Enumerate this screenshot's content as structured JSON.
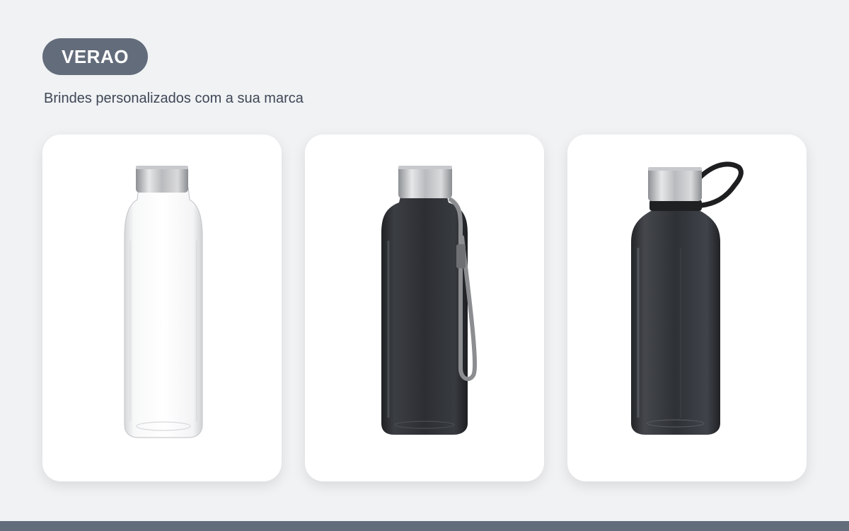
{
  "header": {
    "badge_label": "VERAO",
    "subtitle": "Brindes personalizados com a sua marca"
  },
  "products": [
    {
      "image": "clear-glass-bottle",
      "body_color": "transparent",
      "cap_color": "steel"
    },
    {
      "image": "dark-bottle-with-grey-strap",
      "body_color": "#2e3034",
      "cap_color": "steel"
    },
    {
      "image": "smoke-bottle-with-black-loop",
      "body_color": "#2f3236",
      "cap_color": "steel"
    }
  ],
  "colors": {
    "background": "#f0f2f4",
    "accent": "#636c7b",
    "card": "#ffffff",
    "text": "#3f4756"
  }
}
